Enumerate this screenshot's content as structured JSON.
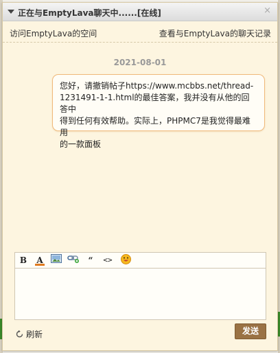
{
  "window": {
    "title": "正在与EmptyLava聊天中......[在线]",
    "close_symbol": "×"
  },
  "links": {
    "visit_space": "访问EmptyLava的空间",
    "view_history": "查看与EmptyLava的聊天记录"
  },
  "conversation": {
    "date": "2021-08-01",
    "messages": [
      {
        "text": "您好，请撤销帖子https://www.mcbbs.net/thread-\n1231491-1-1.html的最佳答案，我并没有从他的回答中\n得到任何有效帮助。实际上，PHPMC7是我觉得最难用\n的一款面板"
      }
    ]
  },
  "toolbar": {
    "bold_label": "B",
    "color_label": "A",
    "quote_label": "“",
    "code_label": "<>",
    "icons": [
      "bold-icon",
      "font-color-icon",
      "image-icon",
      "link-icon",
      "quote-icon",
      "code-icon",
      "emoji-icon"
    ],
    "font_color_accent": "#e07b20"
  },
  "composer": {
    "value": "",
    "refresh_label": "刷新",
    "send_label": "发送"
  },
  "colors": {
    "background": "#fdf5e0",
    "bubble_border": "#f0b97a",
    "send_button": "#9a7244"
  }
}
